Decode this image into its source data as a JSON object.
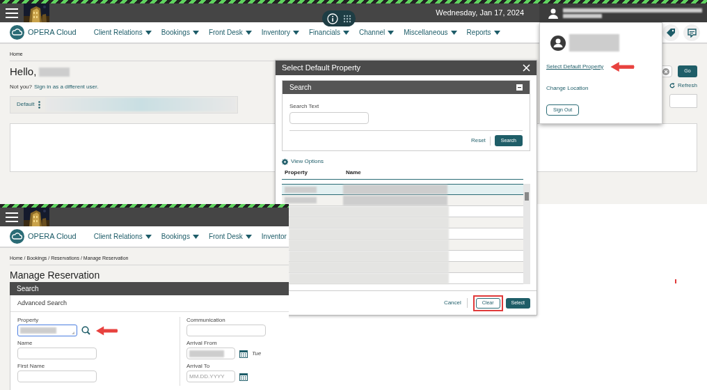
{
  "home_screen": {
    "header": {
      "date": "Wednesday, Jan 17, 2024"
    },
    "nav": {
      "brand": "OPERA Cloud",
      "menus": [
        "Client Relations",
        "Bookings",
        "Front Desk",
        "Inventory",
        "Financials",
        "Channel",
        "Miscellaneous",
        "Reports"
      ]
    },
    "breadcrumb": "Home",
    "greeting": "Hello,",
    "not_you": "Not you?",
    "sign_in_link": "Sign in as a different user.",
    "tab_label": "Default",
    "go_button": "Go",
    "refresh": "Refresh"
  },
  "user_menu": {
    "items": [
      {
        "label": "Select Default Property",
        "kind": "link",
        "pointed": true
      },
      {
        "label": "Change Location",
        "kind": "text",
        "pointed": false
      },
      {
        "label": "Sign Out",
        "kind": "button",
        "pointed": false
      }
    ]
  },
  "dialog": {
    "title": "Select Default Property",
    "search_panel": {
      "title": "Search",
      "field_label": "Search Text",
      "reset": "Reset",
      "search": "Search"
    },
    "view_options": "View Options",
    "columns": [
      "Property",
      "Name"
    ],
    "rows": [
      {
        "selected": true
      },
      {
        "selected": false
      },
      {
        "selected": false
      },
      {
        "selected": false
      },
      {
        "selected": false
      },
      {
        "selected": false
      },
      {
        "selected": false
      },
      {
        "selected": false
      },
      {
        "selected": false
      }
    ],
    "footer": [
      {
        "label": "Cancel",
        "kind": "link",
        "highlighted": false
      },
      {
        "label": "Clear",
        "kind": "outline",
        "highlighted": true
      },
      {
        "label": "Select",
        "kind": "primary",
        "highlighted": false
      }
    ]
  },
  "reservation_screen": {
    "nav": {
      "brand": "OPERA Cloud",
      "menus": [
        "Client Relations",
        "Bookings",
        "Front Desk",
        "Inventor"
      ],
      "last_menu_cut": true
    },
    "breadcrumb": "Home / Bookings / Reservations / Manage Reservation",
    "title": "Manage Reservation",
    "panel_title": "Search",
    "section_title": "Advanced Search",
    "left_fields": [
      {
        "label": "Property",
        "kind": "lookup",
        "redacted": true,
        "pointed": true
      },
      {
        "label": "Name",
        "kind": "text",
        "redacted": false,
        "pointed": false
      },
      {
        "label": "First Name",
        "kind": "text",
        "redacted": false,
        "pointed": false
      }
    ],
    "right_fields": [
      {
        "label": "Communication",
        "kind": "text",
        "redacted": false,
        "pointed": false
      },
      {
        "label": "Arrival From",
        "kind": "date",
        "redacted": true,
        "day": "Tue",
        "pointed": false
      },
      {
        "label": "Arrival To",
        "kind": "date",
        "redacted": false,
        "placeholder": "MM.DD.YYYY",
        "pointed": false
      }
    ]
  }
}
